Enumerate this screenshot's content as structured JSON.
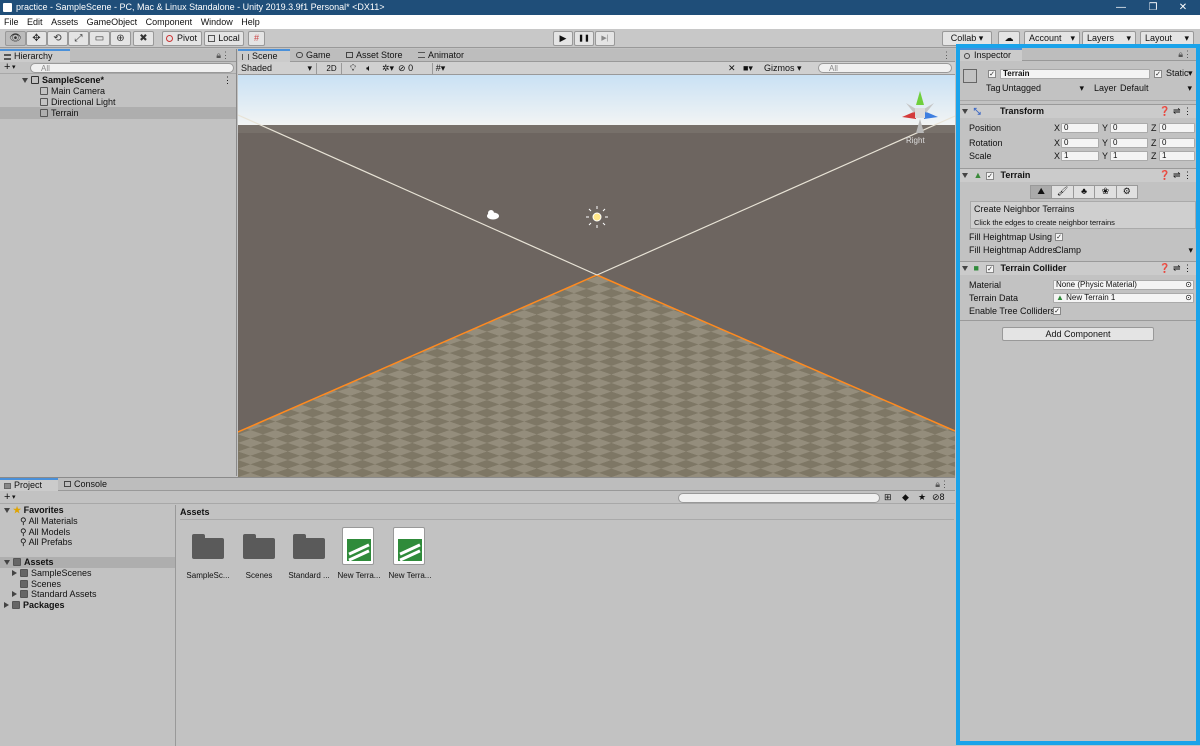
{
  "window": {
    "title": "practice - SampleScene - PC, Mac & Linux Standalone - Unity 2019.3.9f1 Personal* <DX11>",
    "min": "—",
    "max": "❐",
    "close": "✕"
  },
  "menu": [
    "File",
    "Edit",
    "Assets",
    "GameObject",
    "Component",
    "Window",
    "Help"
  ],
  "toolbar": {
    "pivot": "Pivot",
    "local": "Local",
    "tools": {
      "hand": "👁",
      "move": "✥",
      "rotate": "⟲",
      "scale": "⤢",
      "rect": "▭",
      "transform": "⊕",
      "custom": "✖"
    },
    "play": {
      "play": "▶",
      "pause": "❚❚",
      "step": "▶|"
    },
    "collab": "Collab ▾",
    "cloud": "☁",
    "account": "Account",
    "layers": "Layers",
    "layout": "Layout"
  },
  "hierarchy": {
    "tab": "Hierarchy",
    "add": "+",
    "search_placeholder": "All",
    "scene": "SampleScene*",
    "items": [
      "Main Camera",
      "Directional Light",
      "Terrain"
    ]
  },
  "scene": {
    "tabs": [
      "Scene",
      "Game",
      "Asset Store",
      "Animator"
    ],
    "shading": "Shaded",
    "mode2d": "2D",
    "fx_count": "0",
    "gizmos": "Gizmos",
    "search_placeholder": "All",
    "gizmo_label": "Right"
  },
  "project": {
    "tabs": [
      "Project",
      "Console"
    ],
    "add": "+",
    "favorites": {
      "label": "Favorites",
      "items": [
        "All Materials",
        "All Models",
        "All Prefabs"
      ]
    },
    "assets_tree": {
      "label": "Assets",
      "items": [
        "SampleScenes",
        "Scenes",
        "Standard Assets"
      ]
    },
    "packages": "Packages",
    "breadcrumb": "Assets",
    "hidden_count": "8",
    "grid": [
      {
        "name": "SampleSc...",
        "kind": "folder"
      },
      {
        "name": "Scenes",
        "kind": "folder"
      },
      {
        "name": "Standard ...",
        "kind": "folder"
      },
      {
        "name": "New Terra...",
        "kind": "terrain"
      },
      {
        "name": "New Terra...",
        "kind": "terrain"
      }
    ]
  },
  "inspector": {
    "tab": "Inspector",
    "object_name": "Terrain",
    "static": "Static",
    "tag_label": "Tag",
    "tag_value": "Untagged",
    "layer_label": "Layer",
    "layer_value": "Default",
    "transform": {
      "title": "Transform",
      "rows": [
        {
          "label": "Position",
          "x": "0",
          "y": "0",
          "z": "0"
        },
        {
          "label": "Rotation",
          "x": "0",
          "y": "0",
          "z": "0"
        },
        {
          "label": "Scale",
          "x": "1",
          "y": "1",
          "z": "1"
        }
      ],
      "axes": [
        "X",
        "Y",
        "Z"
      ]
    },
    "terrain": {
      "title": "Terrain",
      "neighbor_title": "Create Neighbor Terrains",
      "neighbor_help": "Click the edges to create neighbor terrains",
      "fill_heightmap_using": "Fill Heightmap Using I",
      "fill_heightmap_address": "Fill Heightmap Addres",
      "address_value": "Clamp"
    },
    "collider": {
      "title": "Terrain Collider",
      "material_label": "Material",
      "material_value": "None (Physic Material)",
      "data_label": "Terrain Data",
      "data_value": "New Terrain 1",
      "trees_label": "Enable Tree Colliders"
    },
    "add_component": "Add Component"
  },
  "colors": {
    "highlight": "#1aa3ea",
    "selection": "#ff8a1f",
    "title_bar": "#1f4e79"
  }
}
